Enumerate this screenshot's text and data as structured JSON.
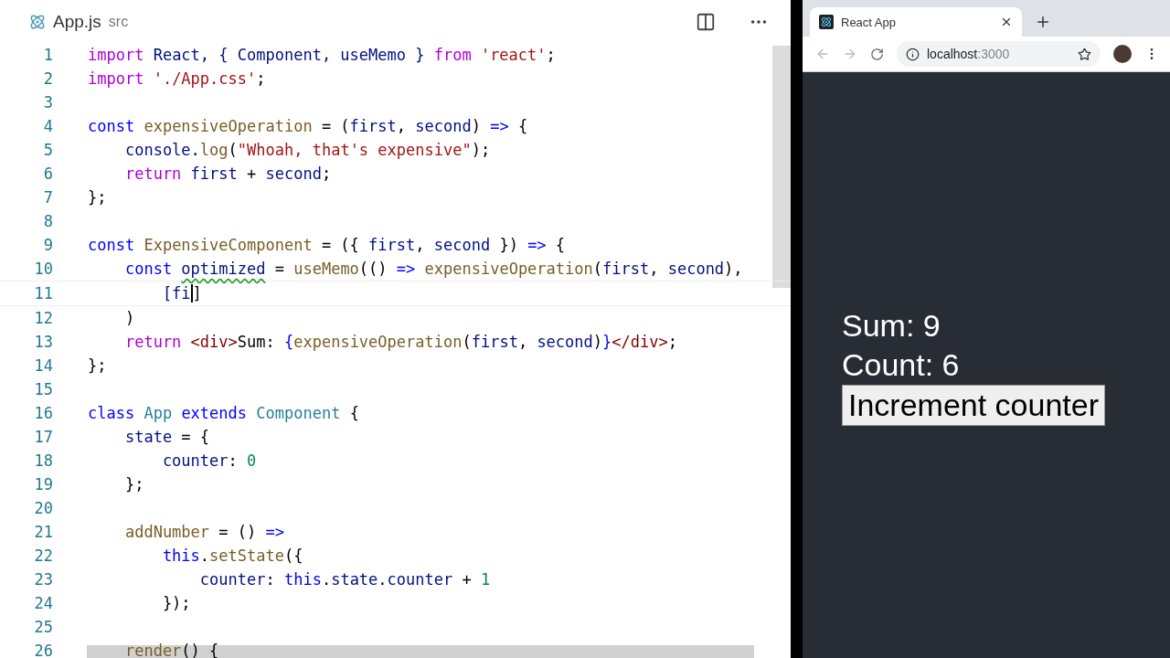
{
  "editor": {
    "tab": {
      "filename": "App.js",
      "folder": "src"
    },
    "lines": [
      {
        "number": "1",
        "tokens": [
          {
            "t": "import",
            "kind": "ctrl"
          },
          {
            "t": " React, { Component, useMemo } ",
            "kind": "var"
          },
          {
            "t": "from",
            "kind": "ctrl"
          },
          {
            "t": " 'react'",
            "kind": "str"
          },
          {
            "t": ";",
            "kind": "plain"
          }
        ]
      },
      {
        "number": "2",
        "tokens": [
          {
            "t": "import",
            "kind": "ctrl"
          },
          {
            "t": " './App.css'",
            "kind": "str"
          },
          {
            "t": ";",
            "kind": "plain"
          }
        ]
      },
      {
        "number": "3"
      },
      {
        "number": "4",
        "tokens": [
          {
            "t": "const",
            "kind": "kw"
          },
          {
            "t": " expensiveOperation",
            "kind": "fn"
          },
          {
            "t": " = (",
            "kind": "plain"
          },
          {
            "t": "first",
            "kind": "var"
          },
          {
            "t": ", ",
            "kind": "plain"
          },
          {
            "t": "second",
            "kind": "var"
          },
          {
            "t": ") ",
            "kind": "plain"
          },
          {
            "t": "=>",
            "kind": "kw"
          },
          {
            "t": " {",
            "kind": "plain"
          }
        ]
      },
      {
        "number": "5",
        "tokens": [
          {
            "t": "    console",
            "kind": "var"
          },
          {
            "t": ".",
            "kind": "plain"
          },
          {
            "t": "log",
            "kind": "fn"
          },
          {
            "t": "(",
            "kind": "plain"
          },
          {
            "t": "\"Whoah, that's expensive\"",
            "kind": "str"
          },
          {
            "t": ");",
            "kind": "plain"
          }
        ]
      },
      {
        "number": "6",
        "tokens": [
          {
            "t": "    return",
            "kind": "ctrl"
          },
          {
            "t": " first",
            "kind": "var"
          },
          {
            "t": " + ",
            "kind": "plain"
          },
          {
            "t": "second",
            "kind": "var"
          },
          {
            "t": ";",
            "kind": "plain"
          }
        ]
      },
      {
        "number": "7",
        "tokens": [
          {
            "t": "};",
            "kind": "plain"
          }
        ]
      },
      {
        "number": "8"
      },
      {
        "number": "9",
        "tokens": [
          {
            "t": "const",
            "kind": "kw"
          },
          {
            "t": " ExpensiveComponent",
            "kind": "fn"
          },
          {
            "t": " = ({ ",
            "kind": "plain"
          },
          {
            "t": "first",
            "kind": "var"
          },
          {
            "t": ", ",
            "kind": "plain"
          },
          {
            "t": "second",
            "kind": "var"
          },
          {
            "t": " }) ",
            "kind": "plain"
          },
          {
            "t": "=>",
            "kind": "kw"
          },
          {
            "t": " {",
            "kind": "plain"
          }
        ]
      },
      {
        "number": "10",
        "tokens": [
          {
            "t": "    const ",
            "kind": "kw"
          },
          {
            "t": "optimized",
            "kind": "var",
            "squiggle": true
          },
          {
            "t": " = ",
            "kind": "plain"
          },
          {
            "t": "useMemo",
            "kind": "fn"
          },
          {
            "t": "(() ",
            "kind": "plain"
          },
          {
            "t": "=>",
            "kind": "kw"
          },
          {
            "t": " expensiveOperation",
            "kind": "fn"
          },
          {
            "t": "(",
            "kind": "plain"
          },
          {
            "t": "first",
            "kind": "var"
          },
          {
            "t": ", ",
            "kind": "plain"
          },
          {
            "t": "second",
            "kind": "var"
          },
          {
            "t": "),",
            "kind": "plain"
          }
        ]
      },
      {
        "number": "11",
        "current": true,
        "tokens": [
          {
            "t": "        [fi",
            "kind": "var"
          },
          {
            "t": "]",
            "kind": "plain"
          }
        ]
      },
      {
        "number": "12",
        "tokens": [
          {
            "t": "    )",
            "kind": "plain"
          }
        ]
      },
      {
        "number": "13",
        "tokens": [
          {
            "t": "    return",
            "kind": "ctrl"
          },
          {
            "t": " <div>",
            "kind": "tag"
          },
          {
            "t": "Sum: ",
            "kind": "plain"
          },
          {
            "t": "{",
            "kind": "kw"
          },
          {
            "t": "expensiveOperation",
            "kind": "fn"
          },
          {
            "t": "(",
            "kind": "plain"
          },
          {
            "t": "first",
            "kind": "var"
          },
          {
            "t": ", ",
            "kind": "plain"
          },
          {
            "t": "second",
            "kind": "var"
          },
          {
            "t": ")",
            "kind": "plain"
          },
          {
            "t": "}",
            "kind": "kw"
          },
          {
            "t": "</div>",
            "kind": "tag"
          },
          {
            "t": ";",
            "kind": "plain"
          }
        ]
      },
      {
        "number": "14",
        "tokens": [
          {
            "t": "};",
            "kind": "plain"
          }
        ]
      },
      {
        "number": "15"
      },
      {
        "number": "16",
        "tokens": [
          {
            "t": "class",
            "kind": "kw"
          },
          {
            "t": " App",
            "kind": "type"
          },
          {
            "t": " extends",
            "kind": "kw"
          },
          {
            "t": " Component",
            "kind": "type"
          },
          {
            "t": " {",
            "kind": "plain"
          }
        ]
      },
      {
        "number": "17",
        "tokens": [
          {
            "t": "    state",
            "kind": "var"
          },
          {
            "t": " = {",
            "kind": "plain"
          }
        ]
      },
      {
        "number": "18",
        "tokens": [
          {
            "t": "        counter",
            "kind": "var"
          },
          {
            "t": ": ",
            "kind": "plain"
          },
          {
            "t": "0",
            "kind": "num"
          }
        ]
      },
      {
        "number": "19",
        "tokens": [
          {
            "t": "    };",
            "kind": "plain"
          }
        ]
      },
      {
        "number": "20"
      },
      {
        "number": "21",
        "tokens": [
          {
            "t": "    addNumber",
            "kind": "fn"
          },
          {
            "t": " = () ",
            "kind": "plain"
          },
          {
            "t": "=>",
            "kind": "kw"
          }
        ]
      },
      {
        "number": "22",
        "tokens": [
          {
            "t": "        this",
            "kind": "kw"
          },
          {
            "t": ".",
            "kind": "plain"
          },
          {
            "t": "setState",
            "kind": "fn"
          },
          {
            "t": "({",
            "kind": "plain"
          }
        ]
      },
      {
        "number": "23",
        "tokens": [
          {
            "t": "            counter",
            "kind": "var"
          },
          {
            "t": ": ",
            "kind": "plain"
          },
          {
            "t": "this",
            "kind": "kw"
          },
          {
            "t": ".",
            "kind": "plain"
          },
          {
            "t": "state",
            "kind": "var"
          },
          {
            "t": ".",
            "kind": "plain"
          },
          {
            "t": "counter",
            "kind": "var"
          },
          {
            "t": " + ",
            "kind": "plain"
          },
          {
            "t": "1",
            "kind": "num"
          }
        ]
      },
      {
        "number": "24",
        "tokens": [
          {
            "t": "        });",
            "kind": "plain"
          }
        ]
      },
      {
        "number": "25"
      },
      {
        "number": "26",
        "tokens": [
          {
            "t": "    render",
            "kind": "fn"
          },
          {
            "t": "() {",
            "kind": "plain"
          }
        ]
      }
    ]
  },
  "browser": {
    "tab": {
      "title": "React App",
      "selected": true
    },
    "address": {
      "host": "localhost",
      "port": ":3000"
    },
    "content": {
      "texts": [
        "Sum: 9",
        "Count: 6"
      ],
      "button": "Increment counter"
    }
  }
}
